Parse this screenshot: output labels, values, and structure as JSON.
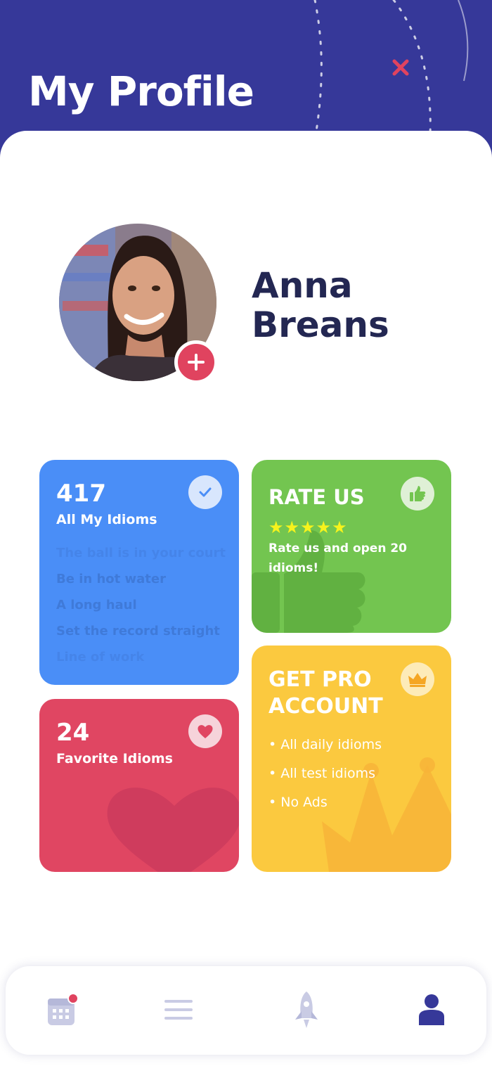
{
  "header": {
    "title": "My Profile"
  },
  "profile": {
    "name_line1": "Anna",
    "name_line2": "Breans"
  },
  "cards": {
    "idioms": {
      "count": "417",
      "label": "All My Idioms",
      "list": [
        "The ball is in your court",
        "Be in hot water",
        "A long haul",
        "Set the record straight",
        "Line of work"
      ]
    },
    "favorites": {
      "count": "24",
      "label": "Favorite Idioms"
    },
    "rate": {
      "title": "RATE US",
      "stars": "★★★★★",
      "rating": 5,
      "text": "Rate us and open 20 idioms!"
    },
    "pro": {
      "title_line1": "GET PRO",
      "title_line2": "ACCOUNT",
      "bullets": [
        "• All daily idioms",
        "• All test idioms",
        "• No Ads"
      ]
    }
  },
  "nav": {
    "items": [
      {
        "icon": "calendar-icon",
        "has_notification": true
      },
      {
        "icon": "menu-icon"
      },
      {
        "icon": "rocket-icon"
      },
      {
        "icon": "profile-icon",
        "active": true
      }
    ]
  },
  "colors": {
    "header_bg": "#363899",
    "blue_card": "#4a8ef7",
    "red_card": "#e04662",
    "green_card": "#73c550",
    "yellow_card": "#fbc93f",
    "accent_pink": "#e0435f",
    "name_color": "#232752"
  }
}
